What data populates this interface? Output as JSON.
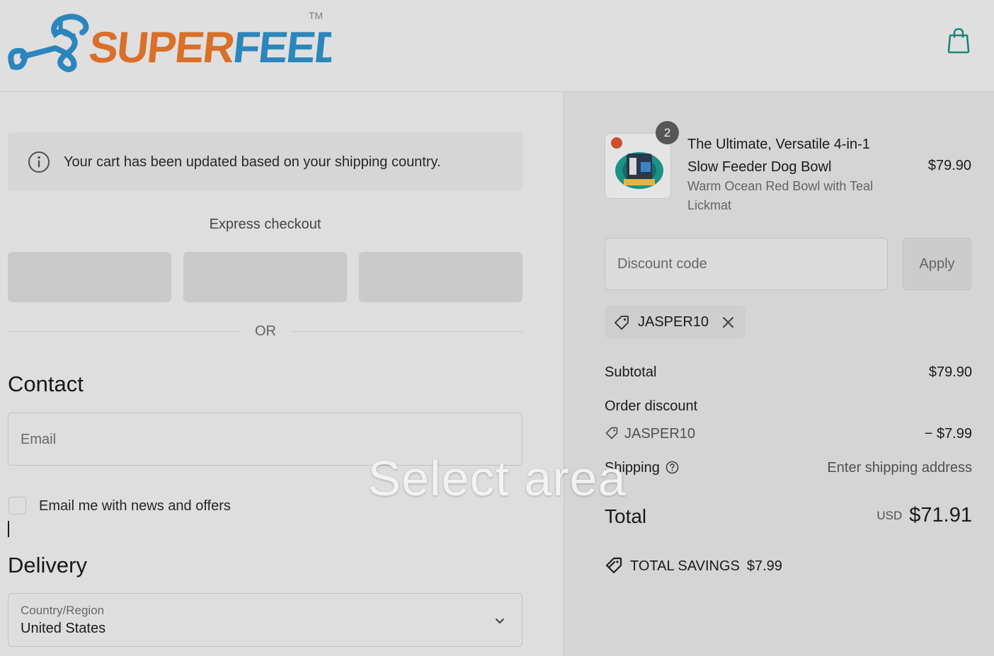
{
  "header": {
    "logo_text": "SUPERFEEDY",
    "trademark": "TM",
    "cart_icon": "shopping-bag-icon"
  },
  "notice": {
    "text": "Your cart has been updated based on your shipping country.",
    "icon": "info-icon"
  },
  "express": {
    "title": "Express checkout",
    "or": "OR"
  },
  "contact": {
    "heading": "Contact",
    "email_placeholder": "Email",
    "newsletter_label": "Email me with news and offers"
  },
  "delivery": {
    "heading": "Delivery",
    "country_label": "Country/Region",
    "country_value": "United States"
  },
  "summary": {
    "item": {
      "quantity": "2",
      "title": "The Ultimate, Versatile 4-in-1 Slow Feeder Dog Bowl",
      "variant": "Warm Ocean Red Bowl with Teal Lickmat",
      "price": "$79.90"
    },
    "discount": {
      "placeholder": "Discount code",
      "apply_label": "Apply",
      "applied_code": "JASPER10"
    },
    "subtotal_label": "Subtotal",
    "subtotal_value": "$79.90",
    "order_discount_label": "Order discount",
    "order_discount_code": "JASPER10",
    "order_discount_value": "− $7.99",
    "shipping_label": "Shipping",
    "shipping_value": "Enter shipping address",
    "total_label": "Total",
    "total_currency": "USD",
    "total_value": "$71.91",
    "savings_label": "TOTAL SAVINGS",
    "savings_value": "$7.99"
  },
  "overlay": {
    "text": "Select area"
  },
  "colors": {
    "logo_orange": "#e8762c",
    "logo_blue": "#2f8fc8",
    "accent_teal": "#1f8f80"
  }
}
